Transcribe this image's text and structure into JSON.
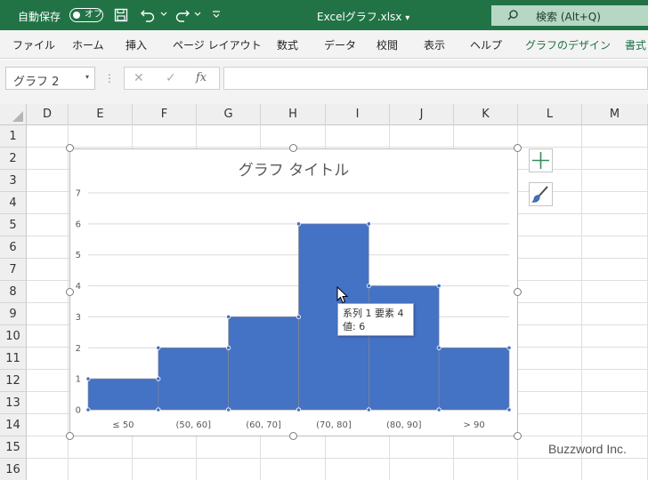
{
  "titlebar": {
    "autosave_label": "自動保存",
    "autosave_state": "オフ",
    "filename": "Excelグラフ.xlsx",
    "filename_caret": "▾",
    "search_label": "検索 (Alt+Q)",
    "bg_color": "#217346"
  },
  "ribbon": {
    "tabs": [
      "ファイル",
      "ホーム",
      "挿入",
      "ページ レイアウト",
      "数式",
      "データ",
      "校閲",
      "表示",
      "ヘルプ",
      "グラフのデザイン",
      "書式"
    ],
    "accent_color": "#1e7145"
  },
  "formula_bar": {
    "name_box": "グラフ 2",
    "name_box_caret": "▾",
    "dots": "⋮",
    "cancel": "✕",
    "enter": "✓",
    "fx": "fx"
  },
  "grid": {
    "columns": [
      "D",
      "E",
      "F",
      "G",
      "H",
      "I",
      "J",
      "K",
      "L",
      "M"
    ],
    "rows": [
      "1",
      "2",
      "3",
      "4",
      "5",
      "6",
      "7",
      "8",
      "9",
      "10",
      "11",
      "12",
      "13",
      "14",
      "15",
      "16"
    ]
  },
  "chart": {
    "title": "グラフ タイトル",
    "fill_color": "#4472c4"
  },
  "chart_data": {
    "type": "bar",
    "categories": [
      "≤ 50",
      "(50, 60]",
      "(60, 70]",
      "(70, 80]",
      "(80, 90]",
      "> 90"
    ],
    "values": [
      1,
      2,
      3,
      6,
      4,
      2
    ],
    "ylim": [
      0,
      7
    ],
    "yticks": [
      "0",
      "1",
      "2",
      "3",
      "4",
      "5",
      "6",
      "7"
    ],
    "grid": true,
    "legend": "none"
  },
  "tooltip": {
    "line1": "系列 1 要素 4",
    "line2": "値: 6"
  },
  "watermark": "Buzzword Inc."
}
